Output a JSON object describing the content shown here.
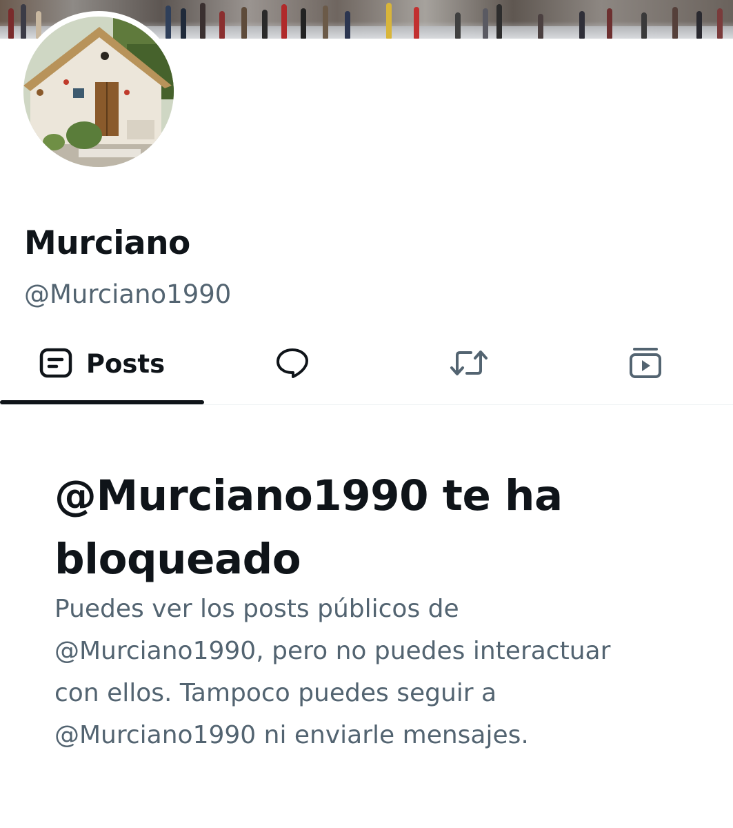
{
  "profile": {
    "display_name": "Murciano",
    "handle": "@Murciano1990"
  },
  "tabs": [
    {
      "label": "Posts",
      "icon": "posts-icon",
      "selected": true
    },
    {
      "label": "",
      "icon": "replies-icon",
      "selected": false
    },
    {
      "label": "",
      "icon": "reposts-icon",
      "selected": false
    },
    {
      "label": "",
      "icon": "media-icon",
      "selected": false
    }
  ],
  "blocked_notice": {
    "title": "@Murciano1990 te ha bloqueado",
    "body": "Puedes ver los posts públicos de @Murciano1990, pero no puedes interactuar con ellos. Tampoco puedes seguir a @Murciano1990 ni enviarle mensajes."
  },
  "colors": {
    "text_primary": "#0f1419",
    "text_secondary": "#536471",
    "divider": "#eff3f4"
  }
}
